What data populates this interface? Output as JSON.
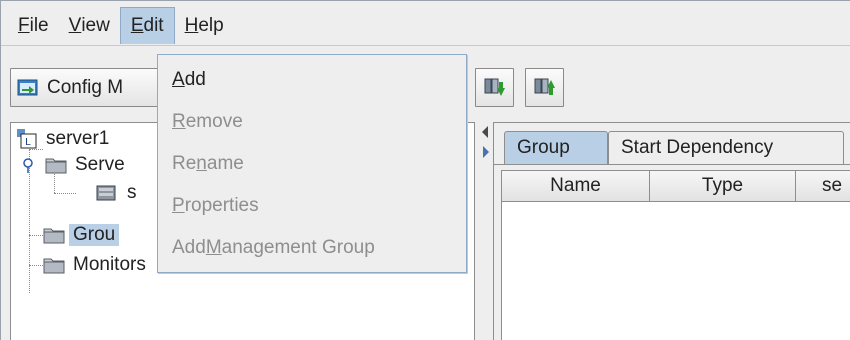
{
  "menubar": {
    "items": [
      {
        "pre": "",
        "mn": "F",
        "post": "ile"
      },
      {
        "pre": "",
        "mn": "V",
        "post": "iew"
      },
      {
        "pre": "",
        "mn": "E",
        "post": "dit"
      },
      {
        "pre": "",
        "mn": "H",
        "post": "elp"
      }
    ]
  },
  "toolbar": {
    "config_label": "Config M",
    "buttons": [
      {
        "icon": "move-down-icon"
      },
      {
        "icon": "move-up-icon"
      }
    ]
  },
  "edit_menu": {
    "items": [
      {
        "pre": "",
        "mn": "A",
        "post": "dd",
        "enabled": true
      },
      {
        "pre": "",
        "mn": "R",
        "post": "emove",
        "enabled": false
      },
      {
        "pre": "Re",
        "mn": "n",
        "post": "ame",
        "enabled": false
      },
      {
        "pre": "",
        "mn": "P",
        "post": "roperties",
        "enabled": false
      },
      {
        "pre": "Add ",
        "mn": "M",
        "post": "anagement Group",
        "enabled": false
      }
    ]
  },
  "tree": {
    "root": "server1",
    "servers": "Serve",
    "server_child": "s",
    "groups": "Grou",
    "monitors": "Monitors"
  },
  "tabs": [
    {
      "label": "Group",
      "active": true
    },
    {
      "label": "Start Dependency",
      "active": false
    }
  ],
  "table": {
    "columns": [
      "Name",
      "Type",
      "se"
    ]
  },
  "colors": {
    "selection": "#b8cfe5",
    "disabled_text": "#8e8e8e"
  }
}
